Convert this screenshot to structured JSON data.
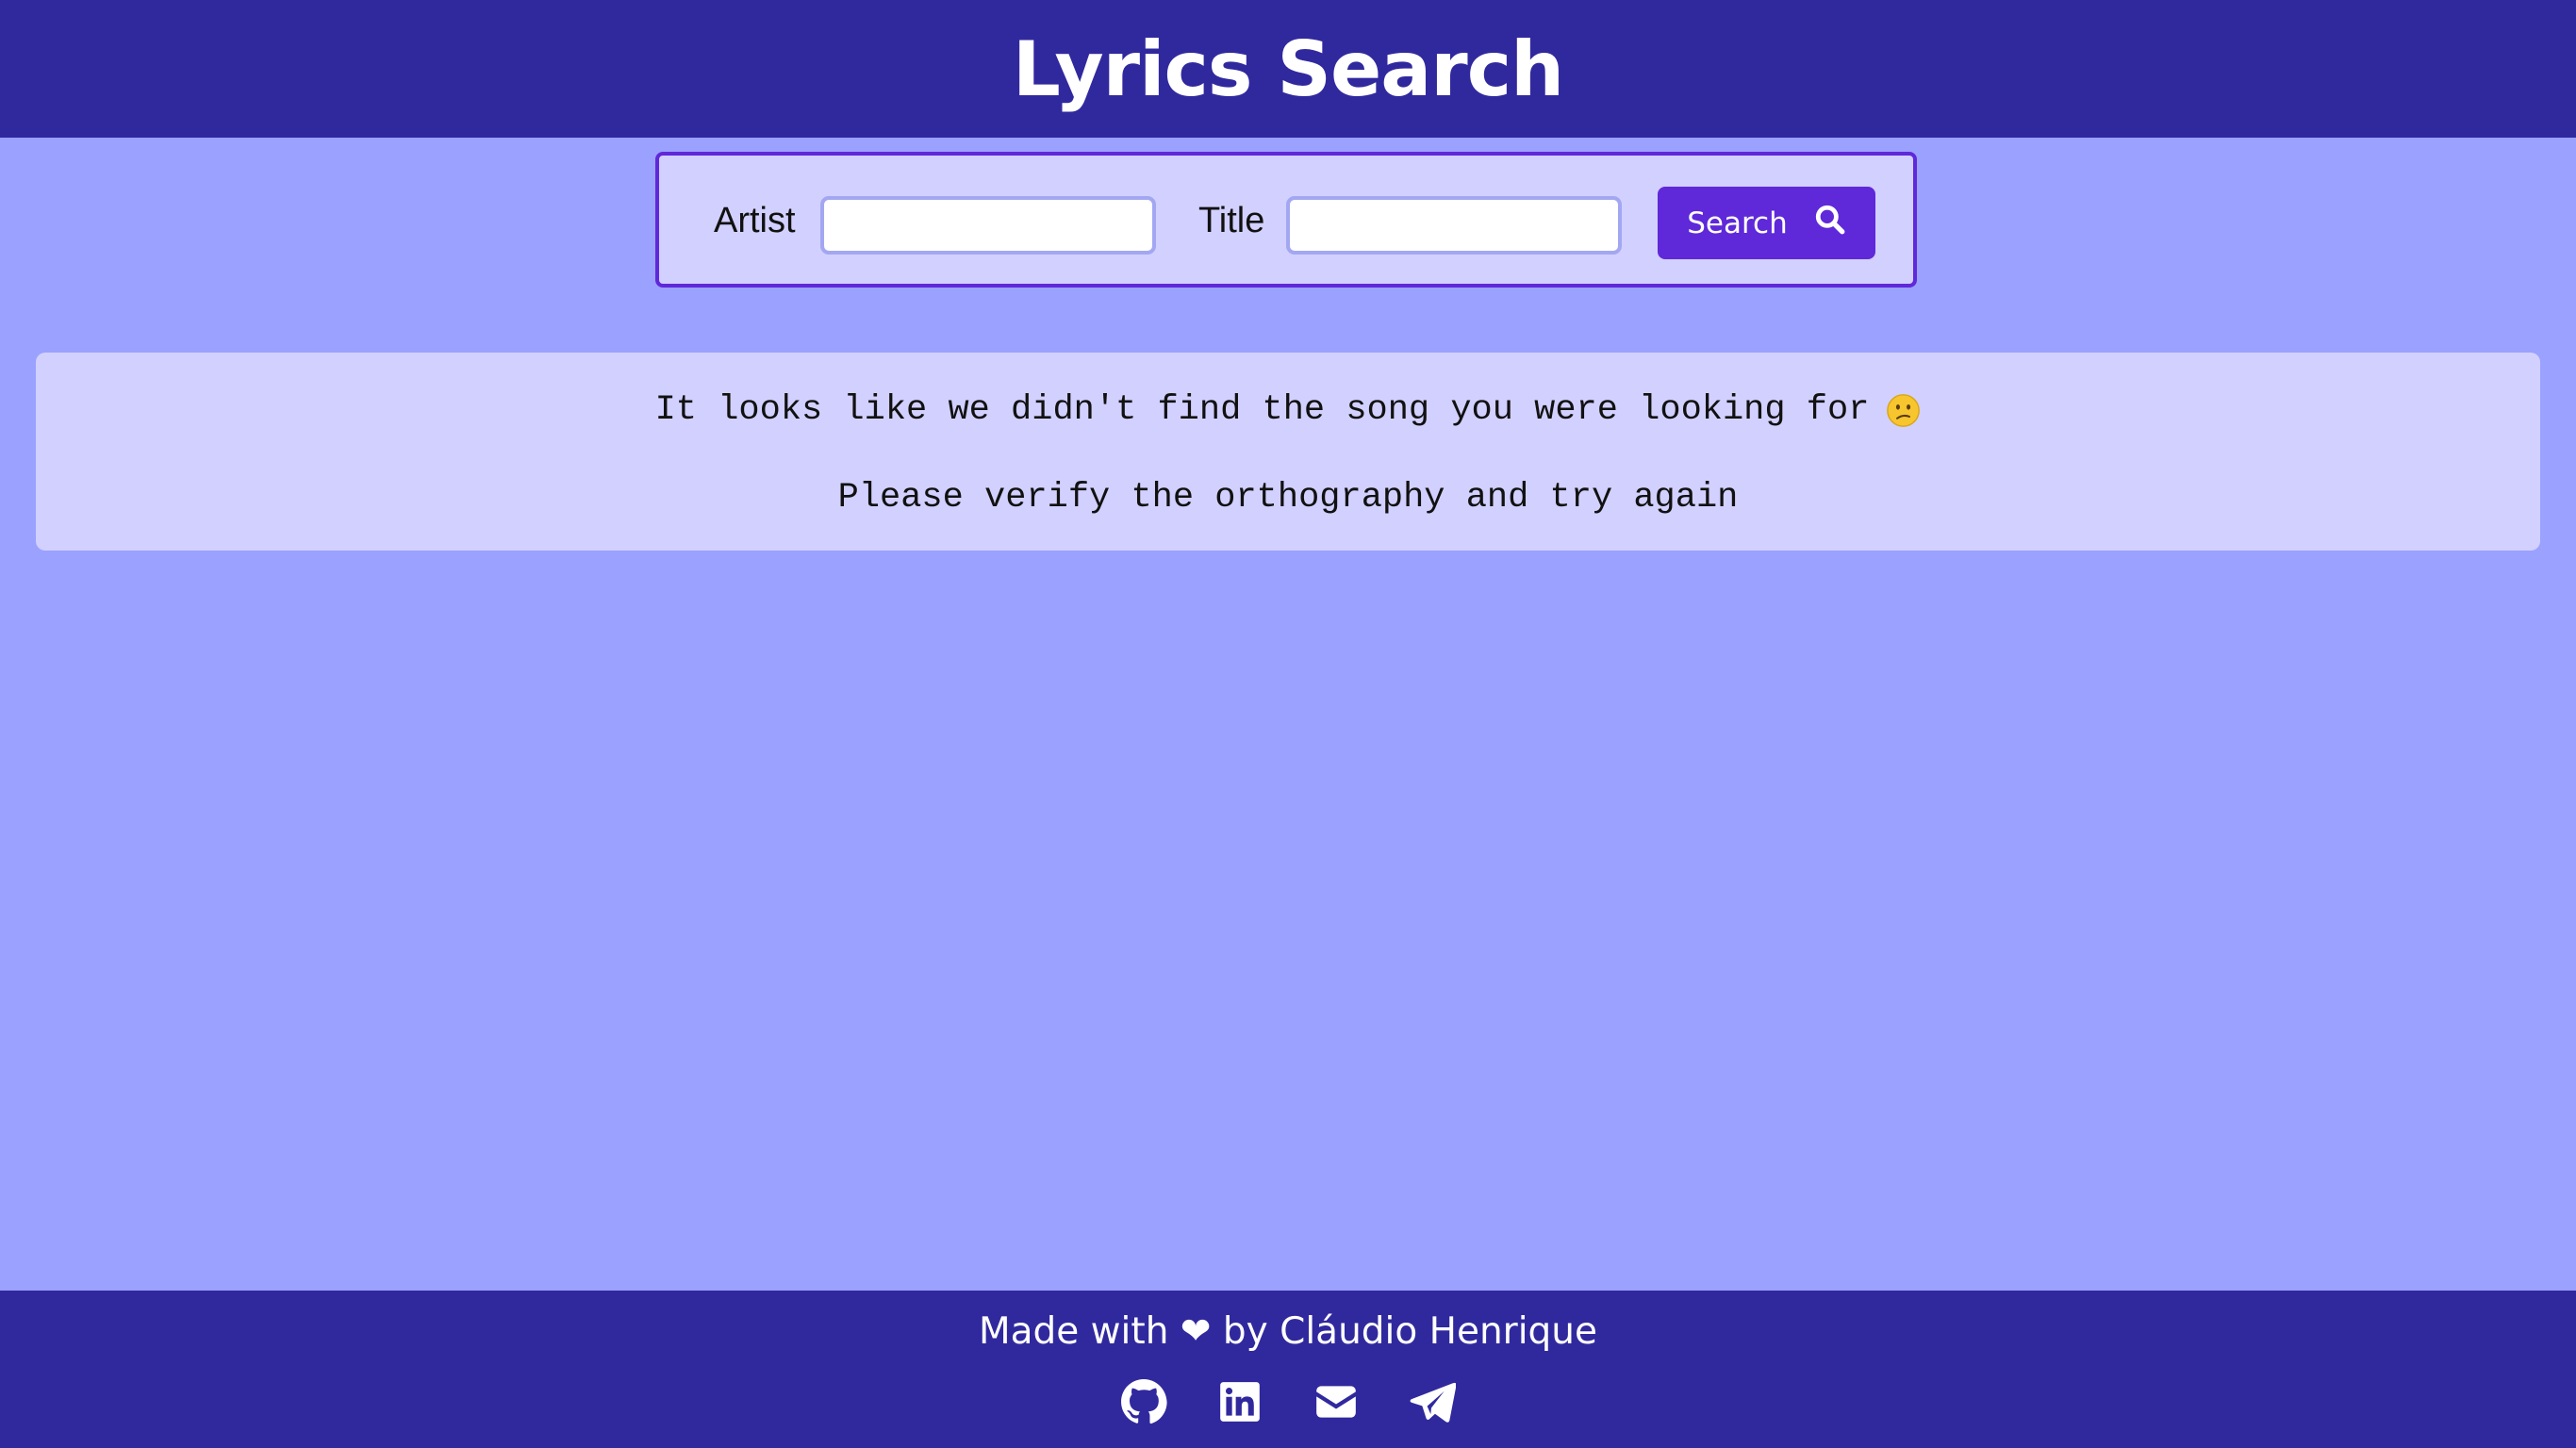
{
  "header": {
    "title": "Lyrics Search"
  },
  "search": {
    "artist_label": "Artist",
    "artist_value": "",
    "title_label": "Title",
    "title_value": "",
    "button_label": "Search",
    "button_icon": "search-icon"
  },
  "message": {
    "line1": "It looks like we didn't find the song you were looking for",
    "emoji": "confused-face-icon",
    "line2": "Please verify the orthography and try again"
  },
  "footer": {
    "credit": "Made with ❤ by Cláudio Henrique",
    "links": [
      "github-icon",
      "linkedin-icon",
      "email-icon",
      "telegram-icon"
    ]
  },
  "colors": {
    "header_bg": "#30299e",
    "page_bg": "#9aa1ff",
    "panel_bg": "#d2d0ff",
    "accent": "#5f28d9"
  }
}
